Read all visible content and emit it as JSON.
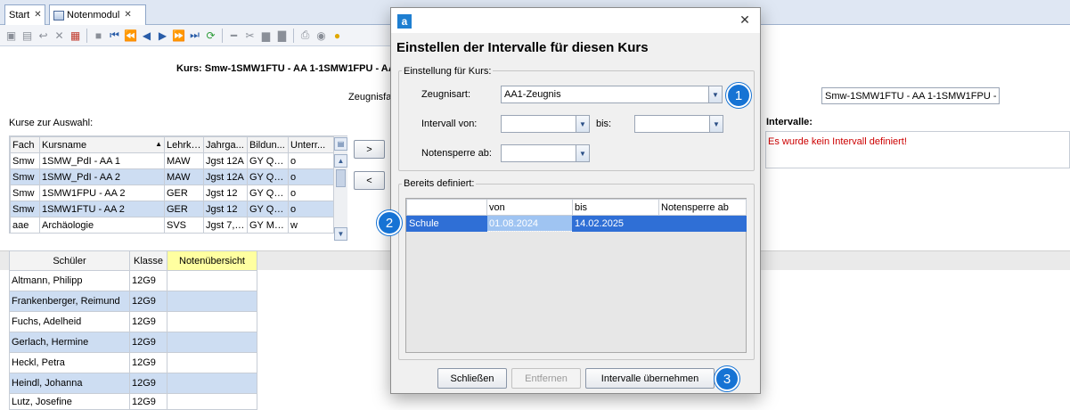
{
  "tabs": [
    {
      "label": "Start"
    },
    {
      "label": "Notenmodul"
    }
  ],
  "toolbar_icons": [
    "save-icon",
    "save-disabled-icon",
    "undo-icon",
    "delete-icon",
    "export-icon",
    "copy-icon",
    "first-icon",
    "prev-fast-icon",
    "prev-icon",
    "next-icon",
    "next-fast-icon",
    "last-icon",
    "refresh-icon",
    "remove-icon",
    "cut-icon",
    "paste-icon",
    "duplicate-icon",
    "print-icon",
    "view-icon",
    "hint-icon"
  ],
  "header": {
    "kurs_label": "Kurs:",
    "kurs_value": "Smw-1SMW1FTU - AA 1-1SMW1FPU - AA",
    "zeugnis_label": "Zeugnisfa",
    "right_field": "Smw-1SMW1FTU - AA 1-1SMW1FPU -",
    "intervalle_label": "Intervalle:",
    "intervalle_message": "Es wurde kein Intervall definiert!"
  },
  "kurse": {
    "label": "Kurse zur Auswahl:",
    "columns": [
      "Fach",
      "Kursname",
      "Lehrkr...",
      "Jahrga...",
      "Bildun...",
      "Unterr..."
    ],
    "rows": [
      [
        "Smw",
        "1SMW_PdI - AA 1",
        "MAW",
        "Jgst 12A",
        "GY Qu...",
        "o"
      ],
      [
        "Smw",
        "1SMW_PdI - AA 2",
        "MAW",
        "Jgst 12A",
        "GY Qu...",
        "o"
      ],
      [
        "Smw",
        "1SMW1FPU - AA 2",
        "GER",
        "Jgst 12",
        "GY Qu...",
        "o"
      ],
      [
        "Smw",
        "1SMW1FTU - AA 2",
        "GER",
        "Jgst 12",
        "GY Qu...",
        "o"
      ],
      [
        "aae",
        "Archäologie",
        "SVS",
        "Jgst 7, ...",
        "GY Mu...",
        "w"
      ]
    ],
    "add_label": ">",
    "remove_label": "<"
  },
  "schueler": {
    "columns": [
      "Schüler",
      "Klasse",
      "Notenübersicht"
    ],
    "rows": [
      [
        "Altmann, Philipp",
        "12G9"
      ],
      [
        "Frankenberger, Reimund",
        "12G9"
      ],
      [
        "Fuchs, Adelheid",
        "12G9"
      ],
      [
        "Gerlach, Hermine",
        "12G9"
      ],
      [
        "Heckl, Petra",
        "12G9"
      ],
      [
        "Heindl, Johanna",
        "12G9"
      ],
      [
        "Lutz, Josefine",
        "12G9"
      ]
    ]
  },
  "dialog": {
    "app_icon_letter": "a",
    "title": "Einstellen der Intervalle für diesen Kurs",
    "group1_label": "Einstellung für Kurs:",
    "zeugnisart_label": "Zeugnisart:",
    "zeugnisart_value": "AA1-Zeugnis",
    "intervall_von_label": "Intervall von:",
    "intervall_von_value": "",
    "bis_label": "bis:",
    "bis_value": "",
    "notensperre_label": "Notensperre ab:",
    "notensperre_value": "",
    "group2_label": "Bereits definiert:",
    "defined_columns": [
      "",
      "von",
      "bis",
      "Notensperre ab"
    ],
    "defined_rows": [
      [
        "Schule",
        "01.08.2024",
        "14.02.2025",
        ""
      ]
    ],
    "buttons": {
      "close": "Schließen",
      "remove": "Entfernen",
      "apply": "Intervalle übernehmen"
    },
    "badges": [
      "1",
      "2",
      "3"
    ]
  },
  "colors": {
    "accent": "#1673d4",
    "selection": "#2f6fd6",
    "error": "#cc0000",
    "highlight_header": "#ffffa0"
  }
}
